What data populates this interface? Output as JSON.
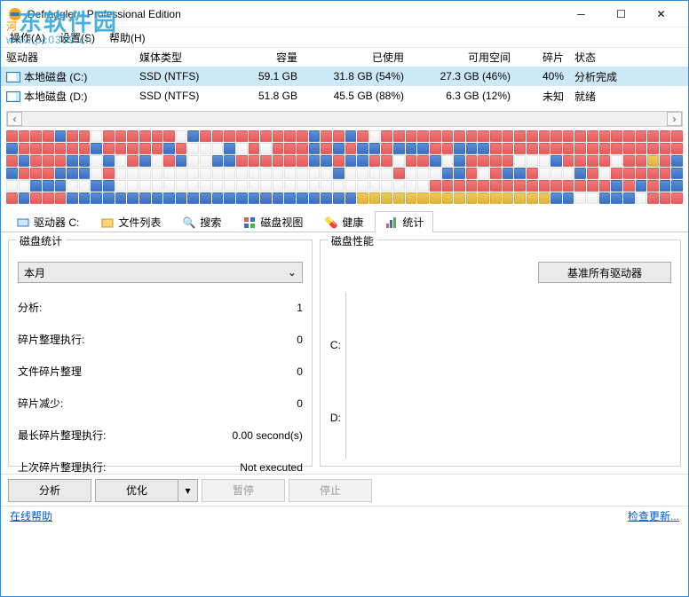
{
  "window": {
    "title": "Defraggler - Professional Edition"
  },
  "watermark": {
    "text": "河东软件园",
    "url": "www.pc0359.cn"
  },
  "menu": {
    "a": "操作(A)",
    "s": "设置(S)",
    "h": "帮助(H)"
  },
  "drive_cols": {
    "drive": "驱动器",
    "media": "媒体类型",
    "cap": "容量",
    "used": "已使用",
    "free": "可用空间",
    "frag": "碎片",
    "status": "状态"
  },
  "drives": [
    {
      "name": "本地磁盘 (C:)",
      "media": "SSD (NTFS)",
      "cap": "59.1 GB",
      "used": "31.8 GB (54%)",
      "free": "27.3 GB (46%)",
      "frag": "40%",
      "status": "分析完成"
    },
    {
      "name": "本地磁盘 (D:)",
      "media": "SSD (NTFS)",
      "cap": "51.8 GB",
      "used": "45.5 GB (88%)",
      "free": "6.3 GB (12%)",
      "frag": "未知",
      "status": "就绪"
    }
  ],
  "tabs": {
    "drive": "驱动器 C:",
    "files": "文件列表",
    "search": "搜索",
    "diskview": "磁盘视图",
    "health": "健康",
    "stats": "统计"
  },
  "stats_panel": {
    "title": "磁盘统计",
    "period": "本月",
    "rows": [
      {
        "k": "分析:",
        "v": "1"
      },
      {
        "k": "碎片整理执行:",
        "v": "0"
      },
      {
        "k": "文件碎片整理",
        "v": "0"
      },
      {
        "k": "碎片减少:",
        "v": "0"
      },
      {
        "k": "最长碎片整理执行:",
        "v": "0.00 second(s)"
      },
      {
        "k": "上次碎片整理执行:",
        "v": "Not executed"
      }
    ]
  },
  "perf_panel": {
    "title": "磁盘性能",
    "bench_btn": "基准所有驱动器",
    "yC": "C:",
    "yD": "D:"
  },
  "actions": {
    "analyze": "分析",
    "optimize": "优化",
    "pause": "暂停",
    "stop": "停止"
  },
  "status": {
    "help": "在线帮助",
    "update": "检查更新..."
  },
  "diskmap_rows": [
    "rrrrbrrwrrrrrrwbrrrrrrrrrbrrbrwrrrrrrrrrrrrrrrrrrrrrrrrr",
    "brrrrrrbrrrrrbrwwwbwrwrrrbrbrbbrbbbrrbbbrrrrrrrrrrrrrrrr",
    "rbrrrbbwbwrbwrbwwbbrrrrrrbbrbbrrwrrbwbrrrrwwwbrrrrwrryrb",
    "brrrbbbwrwwwwwwwwwwwwwwwwwwbwwwwrwwwbbrwrbbrwwwbrwrrrrrb",
    "wwbbbwwbbwwwwwwwwwwwwwwwwwwwwwwwwwwrrrrrrrrrrrrrrrbrbrbb",
    "rbrrrbbbbbbbbbbbbbbbbbbbbbbbbyyyyyyyyyyyyyyyybbwwbbbwrrr"
  ]
}
